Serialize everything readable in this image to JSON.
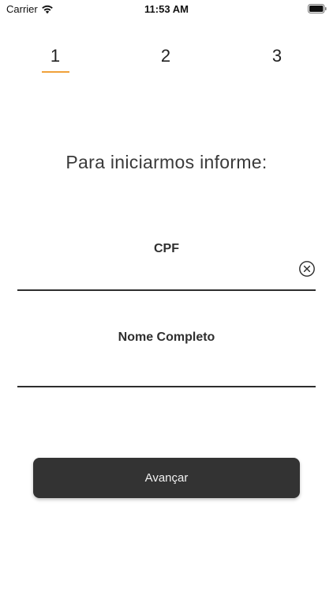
{
  "status_bar": {
    "carrier": "Carrier",
    "time": "11:53 AM"
  },
  "stepper": {
    "steps": [
      "1",
      "2",
      "3"
    ],
    "active_step": 1,
    "accent_color": "#f0a13b"
  },
  "prompt": "Para iniciarmos informe:",
  "form": {
    "cpf": {
      "label": "CPF",
      "value": "",
      "clear_icon": "circle-x-icon"
    },
    "full_name": {
      "label": "Nome Completo",
      "value": ""
    }
  },
  "actions": {
    "next_label": "Avançar",
    "button_color": "#333333"
  }
}
